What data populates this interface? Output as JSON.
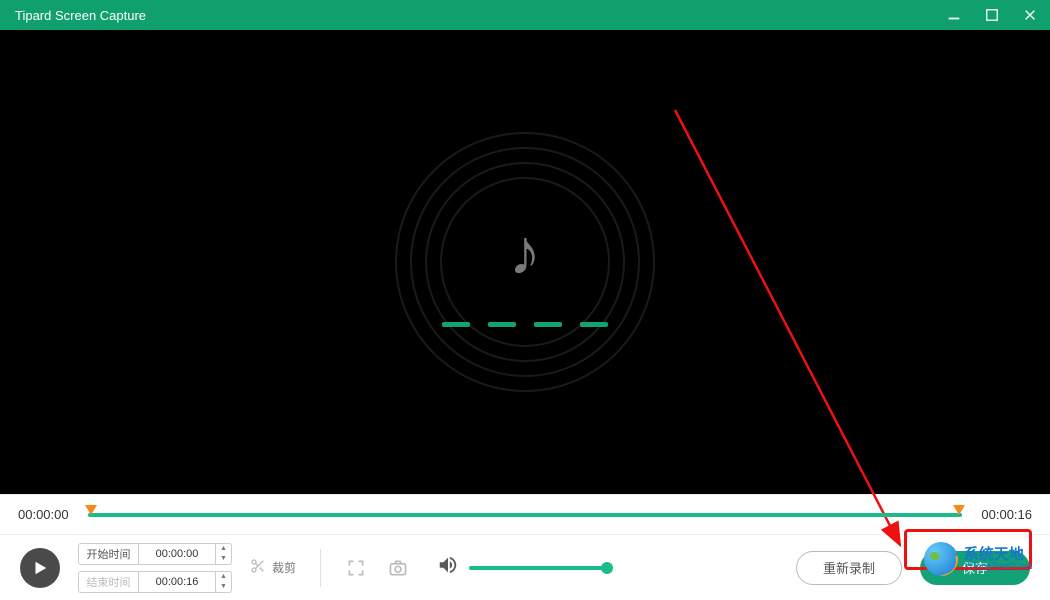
{
  "titlebar": {
    "title": "Tipard Screen Capture"
  },
  "timeline": {
    "start": "00:00:00",
    "end": "00:00:16"
  },
  "time_inputs": {
    "start_label": "开始时间",
    "start_value": "00:00:00",
    "end_label": "结束时间",
    "end_value": "00:00:16"
  },
  "trim": {
    "label": "裁剪"
  },
  "buttons": {
    "re_record": "重新录制",
    "save": "保存"
  },
  "volume": {
    "level_percent": 100
  },
  "icons": {
    "minimize": "minimize-icon",
    "maximize": "maximize-icon",
    "close": "close-icon",
    "play": "play-icon",
    "scissors": "scissors-icon",
    "fullscreen": "fullscreen-icon",
    "camera": "camera-icon",
    "speaker": "speaker-icon",
    "note": "music-note-icon"
  },
  "watermark": {
    "cn": "系统天地",
    "en": "XiTongTianDi.net"
  },
  "colors": {
    "brand": "#0fa06e",
    "accent": "#1abc8c",
    "highlight": "#e11"
  }
}
